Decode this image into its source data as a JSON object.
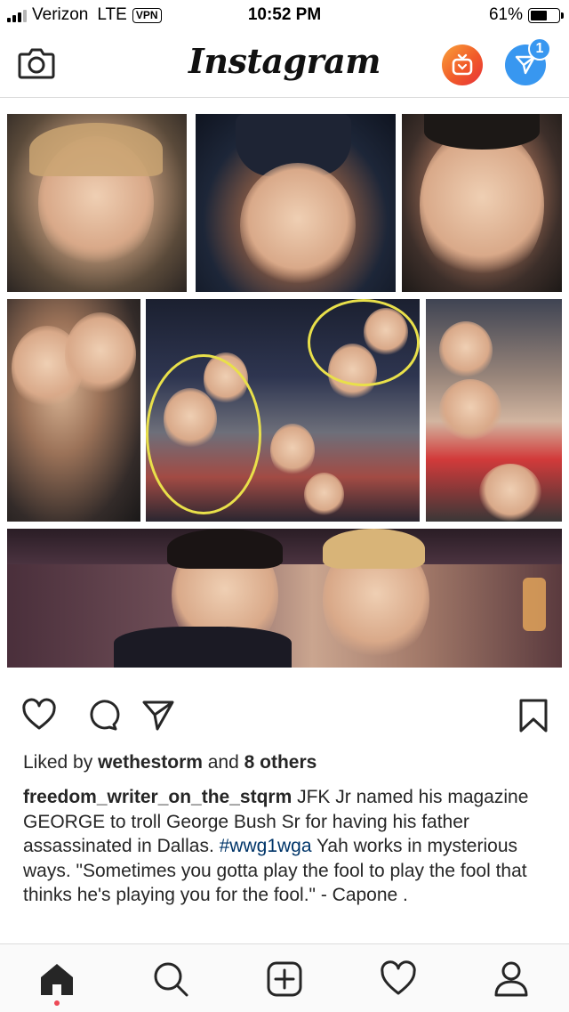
{
  "status_bar": {
    "carrier": "Verizon",
    "network": "LTE",
    "vpn": "VPN",
    "time": "10:52 PM",
    "battery_percent": "61%",
    "battery_level": 0.61
  },
  "nav": {
    "logo": "Instagram",
    "direct_badge": "1"
  },
  "post": {
    "likes": {
      "prefix": "Liked by ",
      "user": "wethestorm",
      "middle": " and ",
      "others": "8 others"
    },
    "caption": {
      "username": "freedom_writer_on_the_stqrm",
      "text_before": " JFK Jr named his magazine GEORGE to troll George Bush Sr for having his father assassinated in Dallas. ",
      "hashtag": "#wwg1wga",
      "text_after": " Yah works in mysterious ways. \"Sometimes you gotta play the fool to play the fool that thinks he's playing you for the fool.\" - Capone ."
    }
  },
  "icons": {
    "camera": "camera-icon",
    "igtv": "igtv-icon",
    "direct": "paper-plane-icon",
    "like": "heart-icon",
    "comment": "comment-icon",
    "share": "share-icon",
    "save": "bookmark-icon",
    "home": "home-icon",
    "search": "search-icon",
    "add": "add-post-icon",
    "activity": "heart-icon",
    "profile": "profile-icon"
  },
  "colors": {
    "accent_blue": "#3897f0",
    "hashtag": "#003569",
    "notification_dot": "#ed4956",
    "highlight_circle": "#e9e04a"
  }
}
